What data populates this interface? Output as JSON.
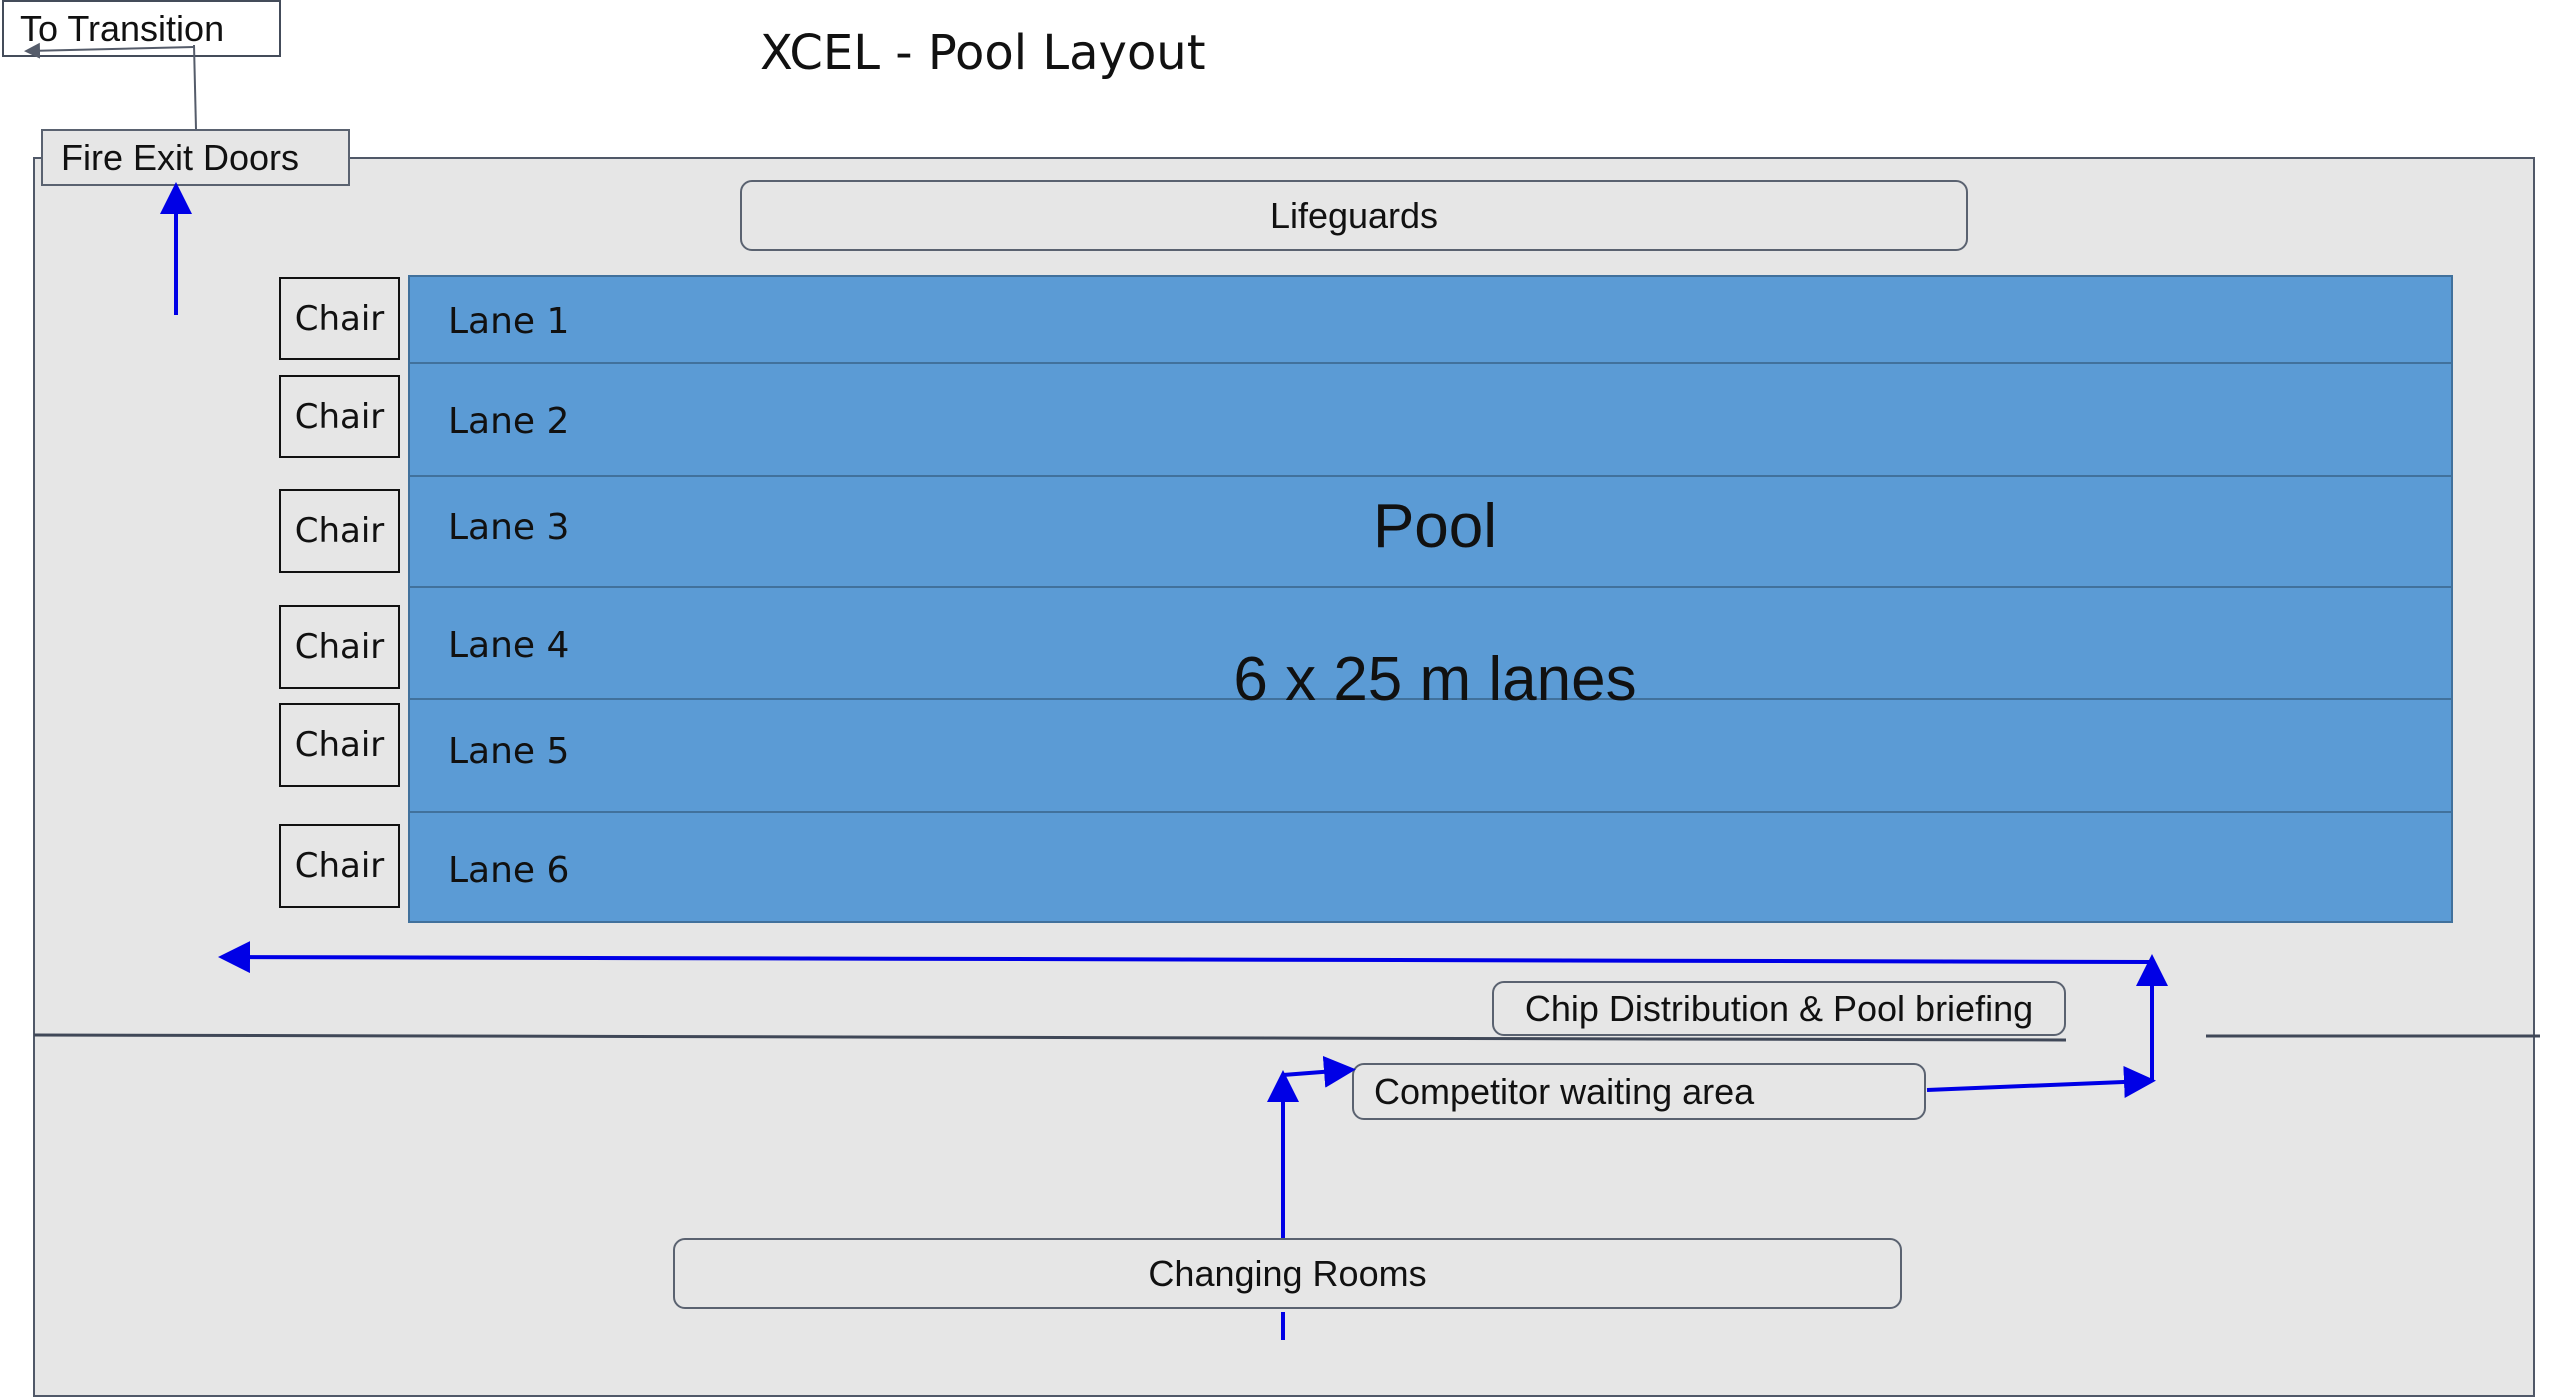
{
  "title": "XCEL - Pool Layout",
  "exits": {
    "transition": "To Transition",
    "fire_exit": "Fire Exit Doors"
  },
  "areas": {
    "lifeguards": "Lifeguards",
    "chip_distribution": "Chip Distribution & Pool briefing",
    "waiting_area": "Competitor waiting area",
    "changing_rooms": "Changing Rooms"
  },
  "pool": {
    "title": "Pool",
    "subtitle": "6 x 25 m lanes",
    "lanes": [
      "Lane 1",
      "Lane 2",
      "Lane 3",
      "Lane 4",
      "Lane 5",
      "Lane 6"
    ],
    "chairs": [
      "Chair",
      "Chair",
      "Chair",
      "Chair",
      "Chair",
      "Chair"
    ]
  },
  "colors": {
    "pool_fill": "#5b9bd5",
    "pool_border": "#41719c",
    "room_fill": "#e6e6e6",
    "flow_arrow": "#0000e6"
  }
}
